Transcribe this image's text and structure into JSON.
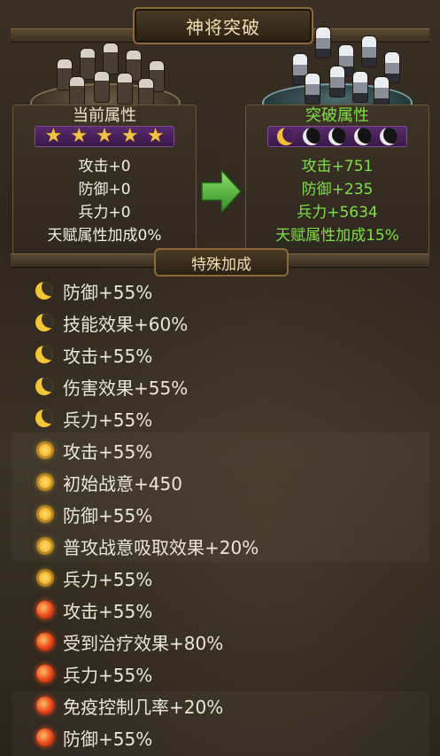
{
  "title": "神将突破",
  "current": {
    "label": "当前属性",
    "stars": 5,
    "stats": [
      "攻击+0",
      "防御+0",
      "兵力+0",
      "天赋属性加成0%"
    ]
  },
  "breakthrough": {
    "label": "突破属性",
    "moons_filled": 1,
    "moons_total": 5,
    "stats": [
      "攻击+751",
      "防御+235",
      "兵力+5634",
      "天赋属性加成15%"
    ]
  },
  "section_title": "特殊加成",
  "bonuses": [
    {
      "icon": "moon-icon",
      "text": "防御+55%"
    },
    {
      "icon": "moon-icon",
      "text": "技能效果+60%"
    },
    {
      "icon": "moon-icon",
      "text": "攻击+55%"
    },
    {
      "icon": "moon-icon",
      "text": "伤害效果+55%"
    },
    {
      "icon": "moon-icon",
      "text": "兵力+55%"
    },
    {
      "icon": "sun-icon",
      "text": "攻击+55%"
    },
    {
      "icon": "sun-icon",
      "text": "初始战意+450"
    },
    {
      "icon": "sun-icon",
      "text": "防御+55%"
    },
    {
      "icon": "sun-icon",
      "text": "普攻战意吸取效果+20%"
    },
    {
      "icon": "sun-icon",
      "text": "兵力+55%"
    },
    {
      "icon": "fire-orb-icon",
      "text": "攻击+55%"
    },
    {
      "icon": "fire-orb-icon",
      "text": "受到治疗效果+80%"
    },
    {
      "icon": "fire-orb-icon",
      "text": "兵力+55%"
    },
    {
      "icon": "fire-orb-icon",
      "text": "免疫控制几率+20%"
    },
    {
      "icon": "fire-orb-icon",
      "text": "防御+55%"
    }
  ],
  "colors": {
    "green_text": "#7ee043",
    "white_text": "#f5f0e4",
    "gold": "#f0c23a",
    "purple_bar": "#4a1f5c"
  }
}
